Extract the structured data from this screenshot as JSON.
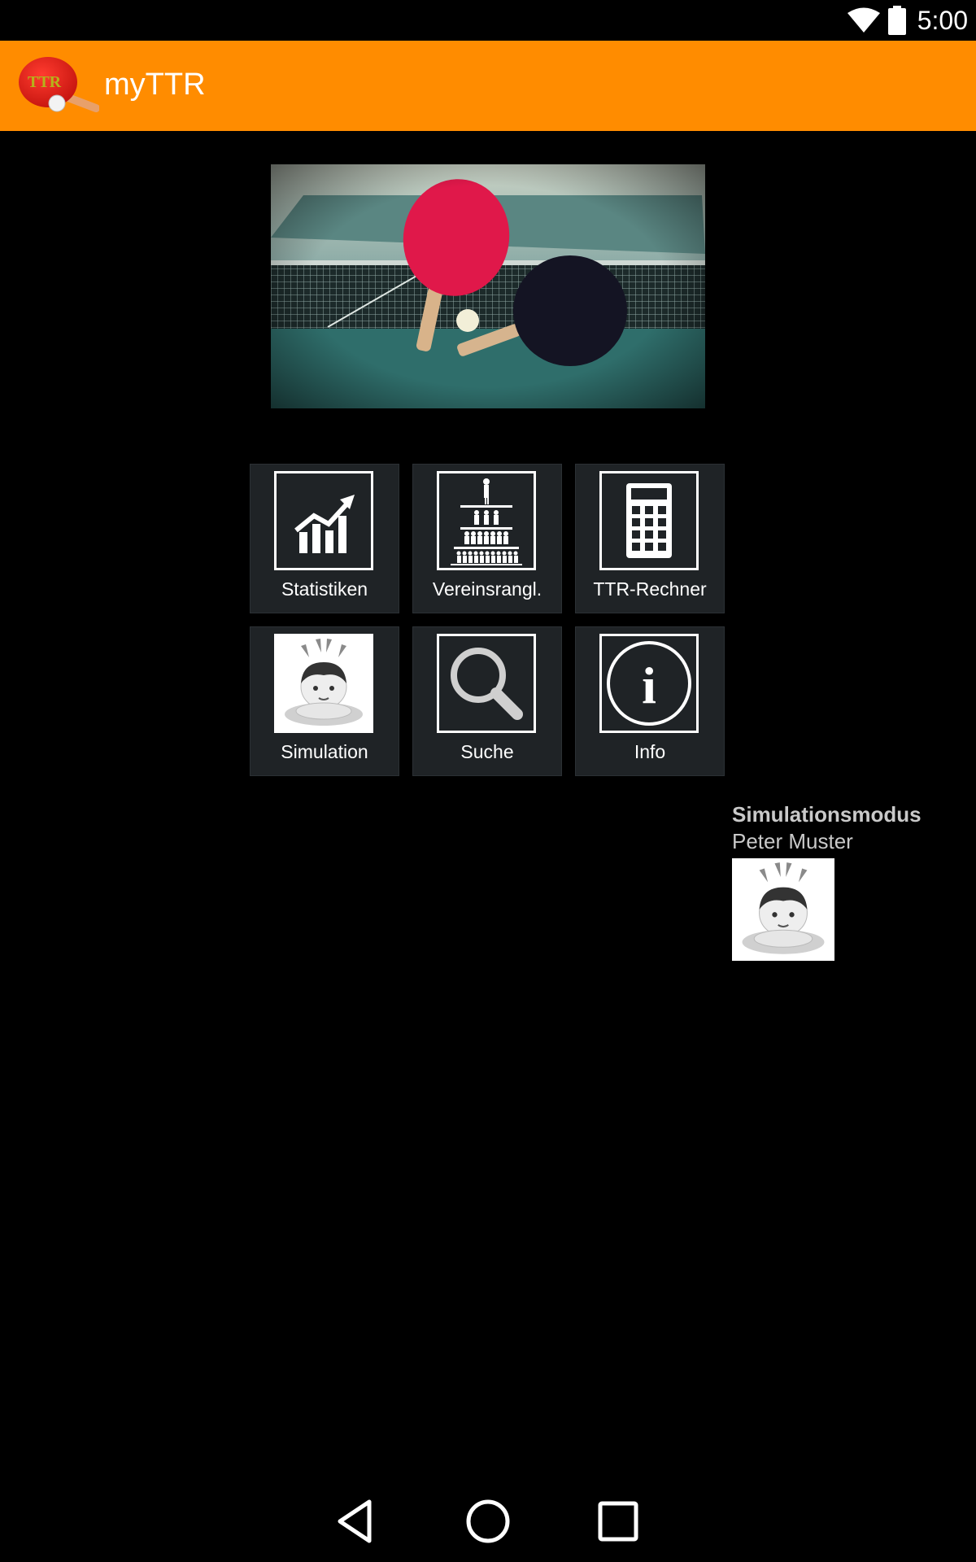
{
  "status_bar": {
    "time": "5:00",
    "icons": [
      "wifi-icon",
      "battery-icon"
    ]
  },
  "app_bar": {
    "title": "myTTR",
    "logo_text": "TTR",
    "background": "#ff8c00"
  },
  "hero": {
    "icon": "table-tennis-photo"
  },
  "tiles": [
    {
      "label": "Statistiken",
      "icon": "chart-icon"
    },
    {
      "label": "Vereinsrangl.",
      "icon": "ranking-pyramid-icon"
    },
    {
      "label": "TTR-Rechner",
      "icon": "calculator-icon"
    },
    {
      "label": "Simulation",
      "icon": "avatar-icon"
    },
    {
      "label": "Suche",
      "icon": "search-icon"
    },
    {
      "label": "Info",
      "icon": "info-icon",
      "glyph": "i"
    }
  ],
  "simulation": {
    "title": "Simulationsmodus",
    "name": "Peter Muster",
    "icon": "avatar-icon"
  },
  "nav_bar": {
    "icons": [
      "back-icon",
      "home-icon",
      "recents-icon"
    ]
  }
}
